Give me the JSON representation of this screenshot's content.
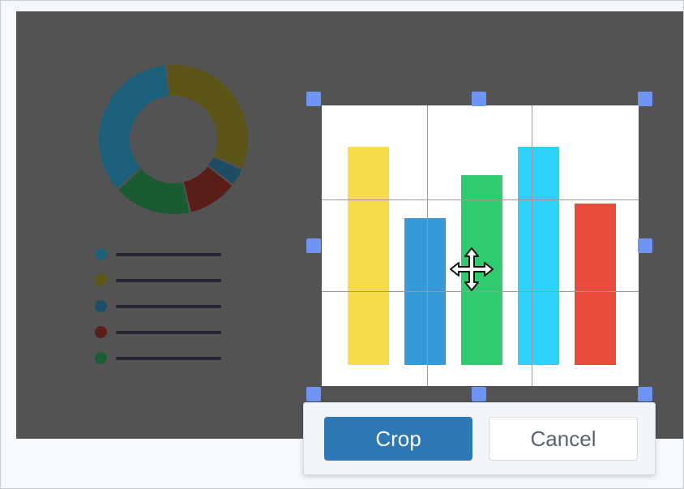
{
  "crop_toolbar": {
    "crop_label": "Crop",
    "cancel_label": "Cancel"
  },
  "background_chart": {
    "donut_slices": [
      {
        "color": "#5c5317",
        "fraction": 0.33
      },
      {
        "color": "#1c4d63",
        "fraction": 0.04
      },
      {
        "color": "#5a1e18",
        "fraction": 0.11
      },
      {
        "color": "#1b5b31",
        "fraction": 0.17
      },
      {
        "color": "#1c5f7a",
        "fraction": 0.35
      }
    ],
    "legend_colors": [
      "#1f5f7a",
      "#5e5518",
      "#1b4f6a",
      "#5c1e18",
      "#1c5c33"
    ]
  },
  "cropped_chart": {
    "bar_colors": [
      "#f7dc4b",
      "#3699d8",
      "#2fcb6e",
      "#2dd3fb",
      "#e84c3c"
    ],
    "bar_levels": [
      0.92,
      0.62,
      0.8,
      0.92,
      0.68
    ]
  },
  "icons": {
    "move_cursor": "move-arrows-icon",
    "resize_handle": "resize-handle-icon"
  },
  "colors": {
    "overlay": "#535353",
    "handle": "#6f95f4",
    "crop_button": "#2e78b5"
  }
}
